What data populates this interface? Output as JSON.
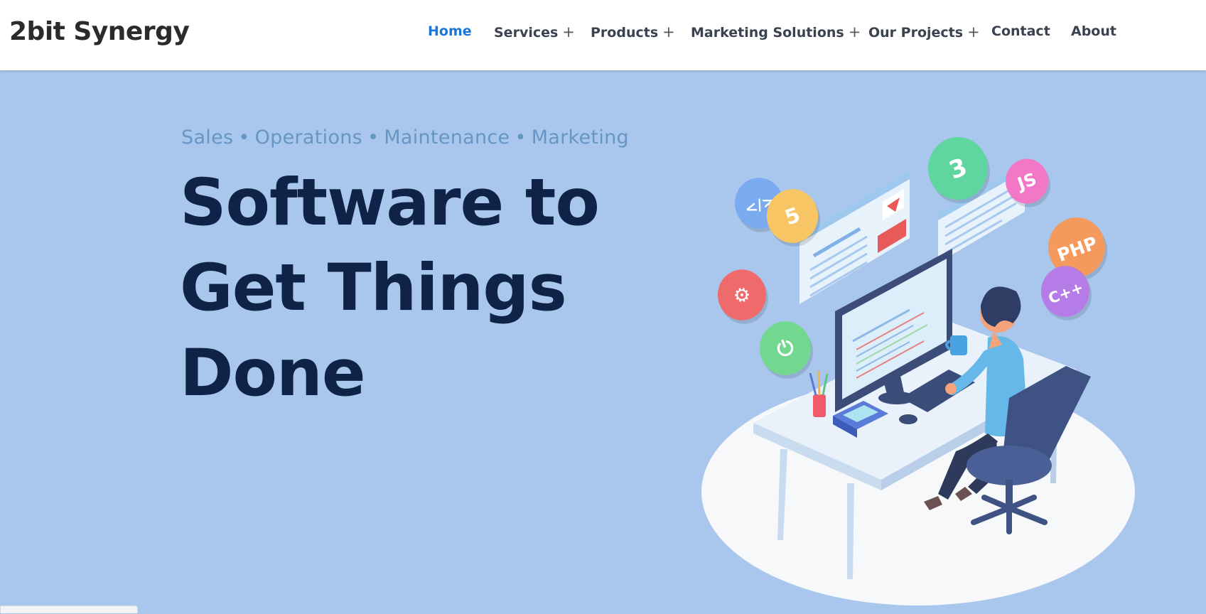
{
  "brand": {
    "name": "2bit Synergy"
  },
  "nav": {
    "items": [
      {
        "label": "Home",
        "active": true,
        "has_submenu": false
      },
      {
        "label": "Services",
        "active": false,
        "has_submenu": true
      },
      {
        "label": "Products",
        "active": false,
        "has_submenu": true
      },
      {
        "label": "Marketing Solutions",
        "active": false,
        "has_submenu": true
      },
      {
        "label": "Our Projects",
        "active": false,
        "has_submenu": true
      },
      {
        "label": "Contact",
        "active": false,
        "has_submenu": false
      },
      {
        "label": "About",
        "active": false,
        "has_submenu": false
      }
    ],
    "submenu_glyph": "+"
  },
  "hero": {
    "tagline_items": [
      "Sales",
      "Operations",
      "Maintenance",
      "Marketing"
    ],
    "tagline_separator": "•",
    "headline_lines": [
      "Software to",
      "Get Things",
      "Done"
    ],
    "illustration": {
      "badges": [
        {
          "icon": "code-tag-icon",
          "glyph": "</>",
          "color": "#7aaaf0"
        },
        {
          "icon": "html5-icon",
          "glyph": "5",
          "color": "#f8c564"
        },
        {
          "icon": "css3-icon",
          "glyph": "3",
          "color": "#5fd6a0"
        },
        {
          "icon": "javascript-icon",
          "glyph": "JS",
          "color": "#f277c6"
        },
        {
          "icon": "php-icon",
          "glyph": "PHP",
          "color": "#f49a5c"
        },
        {
          "icon": "cplusplus-icon",
          "glyph": "C++",
          "color": "#b57be6"
        },
        {
          "icon": "gear-icon",
          "glyph": "⚙",
          "color": "#ef6b6b"
        },
        {
          "icon": "power-icon",
          "glyph": "⏻",
          "color": "#72d890"
        }
      ]
    }
  },
  "colors": {
    "background": "#a9c6ec",
    "navbar": "#ffffff",
    "nav_active": "#1a77d8",
    "headline": "#0e2346",
    "tagline": "#6796c4"
  }
}
